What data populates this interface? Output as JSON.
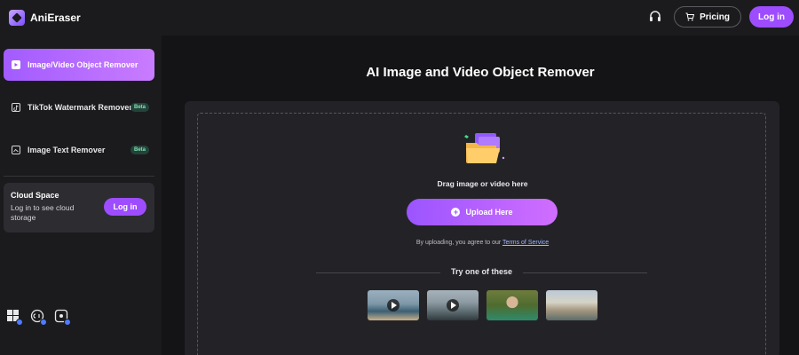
{
  "app": {
    "name": "AniEraser"
  },
  "header": {
    "pricing_label": "Pricing",
    "login_label": "Log in"
  },
  "sidebar": {
    "items": [
      {
        "label": "Image/Video Object Remover",
        "badge": ""
      },
      {
        "label": "TikTok Watermark Remover",
        "badge": "Beta"
      },
      {
        "label": "Image Text Remover",
        "badge": "Beta"
      }
    ],
    "cloud": {
      "title": "Cloud Space",
      "description": "Log in to see cloud storage",
      "login_label": "Log in"
    }
  },
  "main": {
    "title": "AI Image and Video Object Remover",
    "drag_text": "Drag image or video here",
    "upload_label": "Upload Here",
    "agree_prefix": "By uploading, you agree to our",
    "terms_label": "Terms of Service",
    "try_label": "Try one of these"
  },
  "colors": {
    "accent": "#9d4dff",
    "accent_light": "#d06eff",
    "badge_text": "#7fe3b0"
  }
}
